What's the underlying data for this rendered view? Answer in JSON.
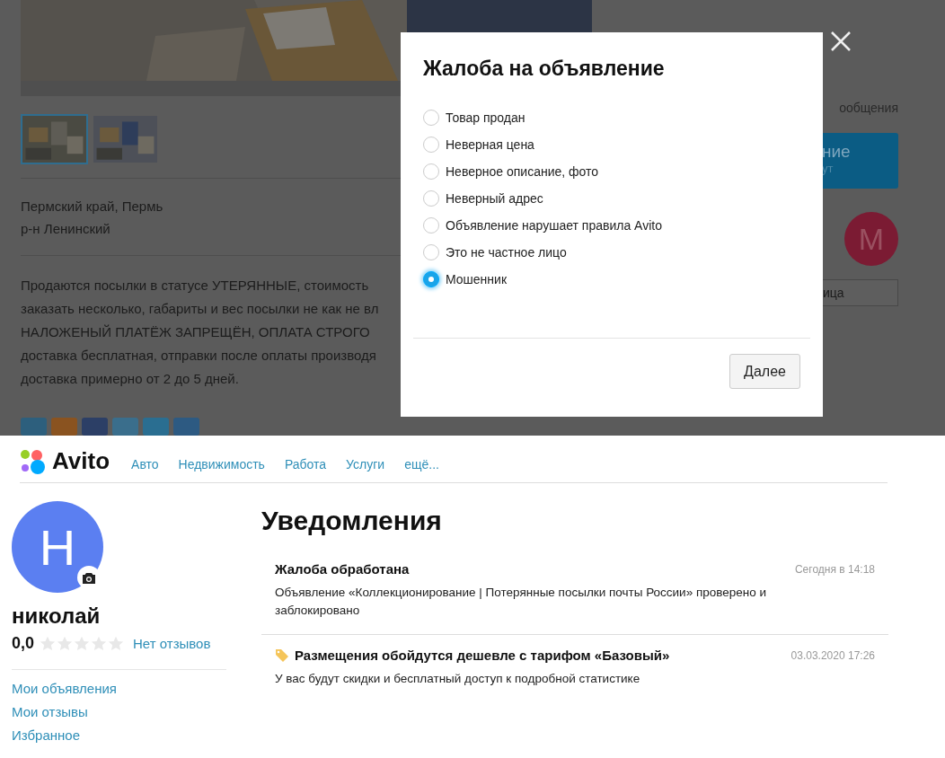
{
  "listing": {
    "thumbnails": [
      {
        "selected": true
      },
      {
        "selected": false
      }
    ],
    "location": [
      "Пермский край, Пермь",
      "р-н Ленинский"
    ],
    "description_lines": [
      "Продаются посылки в статусе УТЕРЯННЫЕ, стоимость",
      "заказать несколько, габариты и вес посылки не как не вл",
      "НАЛОЖЕНЫЙ ПЛАТЁЖ ЗАПРЕЩЁН, ОПЛАТА СТРОГО",
      "доставка бесплатная, отправки после оплаты производя",
      "доставка примерно от 2 до 5 дней."
    ]
  },
  "seller_panel": {
    "caption": "ообщения",
    "button_title": "ние",
    "button_subtitle": "ут",
    "avatar_letter": "М",
    "field_value": "ица"
  },
  "modal": {
    "title": "Жалоба на объявление",
    "options": [
      {
        "label": "Товар продан",
        "selected": false
      },
      {
        "label": "Неверная цена",
        "selected": false
      },
      {
        "label": "Неверное описание, фото",
        "selected": false
      },
      {
        "label": "Неверный адрес",
        "selected": false
      },
      {
        "label": "Объявление нарушает правила Avito",
        "selected": false
      },
      {
        "label": "Это не частное лицо",
        "selected": false
      },
      {
        "label": "Мошенник",
        "selected": true
      }
    ],
    "next_button": "Далее"
  },
  "header": {
    "logo": "Avito",
    "nav": [
      "Авто",
      "Недвижимость",
      "Работа",
      "Услуги",
      "ещё..."
    ]
  },
  "profile": {
    "avatar_letter": "Н",
    "name": "николай",
    "rating": "0,0",
    "stars": 0,
    "reviews_link": "Нет отзывов",
    "menu": [
      "Мои объявления",
      "Мои отзывы",
      "Избранное"
    ]
  },
  "notifications": {
    "title": "Уведомления",
    "items": [
      {
        "kind": "plain",
        "title": "Жалоба обработана",
        "time": "Сегодня в 14:18",
        "body": "Объявление «Коллекционирование | Потерянные посылки почты России» проверено и заблокировано"
      },
      {
        "kind": "promo",
        "title": "Размещения обойдутся дешевле с тарифом «Базовый»",
        "time": "03.03.2020 17:26",
        "body": "У вас будут скидки и бесплатный доступ к подробной статистике"
      }
    ]
  }
}
